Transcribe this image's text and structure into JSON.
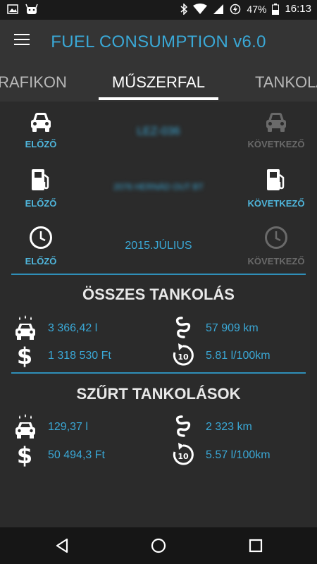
{
  "status_bar": {
    "battery": "47%",
    "time": "16:13"
  },
  "app": {
    "title": "FUEL CONSUMPTION v6.0"
  },
  "tabs": [
    {
      "label": "GRAFIKON"
    },
    {
      "label": "MŰSZERFAL",
      "active": true
    },
    {
      "label": "TANKOLÁS"
    }
  ],
  "nav": {
    "vehicle": {
      "prev": "ELŐZŐ",
      "next": "KÖVETKEZŐ",
      "value": "LEZ-036",
      "prev_enabled": true,
      "next_enabled": false
    },
    "refuel": {
      "prev": "ELŐZŐ",
      "next": "KÖVETKEZŐ",
      "value": "2076 HERNÁD OUT BT",
      "prev_enabled": true,
      "next_enabled": true
    },
    "period": {
      "prev": "ELŐZŐ",
      "next": "KÖVETKEZŐ",
      "value": "2015.JÚLIUS",
      "prev_enabled": true,
      "next_enabled": false
    }
  },
  "summary_all": {
    "title": "ÖSSZES TANKOLÁS",
    "fuel": "3 366,42 l",
    "distance": "57 909 km",
    "cost": "1 318 530 Ft",
    "consumption": "5.81 l/100km"
  },
  "summary_filtered": {
    "title": "SZŰRT TANKOLÁSOK",
    "fuel": "129,37 l",
    "distance": "2 323 km",
    "cost": "50 494,3 Ft",
    "consumption": "5.57 l/100km"
  },
  "icons": {
    "car": "car-icon",
    "pump": "fuel-pump-icon",
    "clock": "clock-icon",
    "fuel_amount": "fuel-car-icon",
    "road": "road-icon",
    "money": "dollar-icon",
    "consumption": "consumption-10-icon"
  },
  "colors": {
    "accent": "#3aa8d6",
    "label_enabled": "#4fb6dc",
    "label_disabled": "#6a6a6a",
    "divider": "#2f8fb8"
  }
}
